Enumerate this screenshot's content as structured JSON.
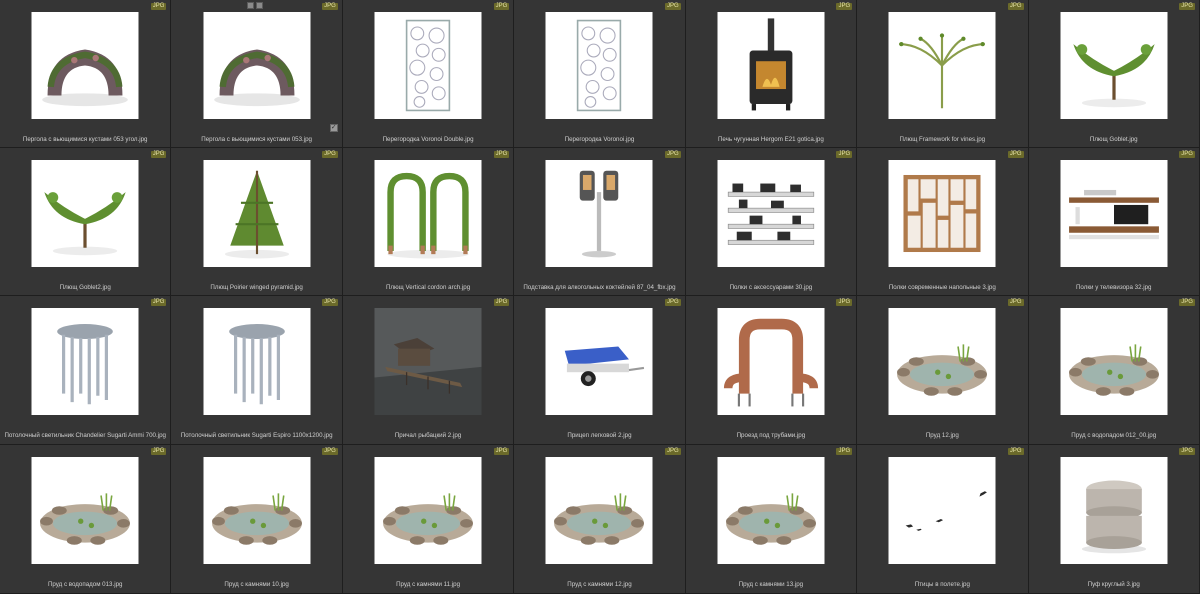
{
  "badge_label": "JPG",
  "thumbnails": [
    {
      "caption": "Пергола с вьющимися кустами 053 угол.jpg",
      "icon": "pergola-bush-icon"
    },
    {
      "caption": "Пергола с вьющимися кустами 053.jpg",
      "icon": "pergola-bush-icon",
      "selected": true
    },
    {
      "caption": "Перегородка Voronoi Double.jpg",
      "icon": "partition-icon"
    },
    {
      "caption": "Перегородка Voronoi.jpg",
      "icon": "partition-icon"
    },
    {
      "caption": "Печь чугунная Hergom E21 gotica.jpg",
      "icon": "stove-icon"
    },
    {
      "caption": "Плющ Framework for vines.jpg",
      "icon": "vine-frame-icon"
    },
    {
      "caption": "Плющ Goblet.jpg",
      "icon": "goblet-plant-icon"
    },
    {
      "caption": "Плющ Goblet2.jpg",
      "icon": "goblet-plant-icon"
    },
    {
      "caption": "Плющ Poirier winged pyramid.jpg",
      "icon": "pyramid-tree-icon"
    },
    {
      "caption": "Плющ Vertical cordon arch.jpg",
      "icon": "arch-plant-icon"
    },
    {
      "caption": "Подставка для алкогольных коктейлей 87_04_fbx.jpg",
      "icon": "drink-dispenser-icon"
    },
    {
      "caption": "Полки с аксессуарами 30.jpg",
      "icon": "shelves-icon"
    },
    {
      "caption": "Полки современные напольные 3.jpg",
      "icon": "bookcase-icon"
    },
    {
      "caption": "Полки у телевизора 32.jpg",
      "icon": "tv-shelves-icon"
    },
    {
      "caption": "Потолочный светильник Chandelier Sugarti Ammi 700.jpg",
      "icon": "chandelier-icon"
    },
    {
      "caption": "Потолочный светильник Sugarti Espiro 1100x1200.jpg",
      "icon": "chandelier-icon"
    },
    {
      "caption": "Причал рыбацкий 2.jpg",
      "icon": "pier-icon"
    },
    {
      "caption": "Прицеп легковой 2.jpg",
      "icon": "trailer-icon"
    },
    {
      "caption": "Проезд под трубами.jpg",
      "icon": "pipe-arch-icon"
    },
    {
      "caption": "Пруд 12.jpg",
      "icon": "pond-icon"
    },
    {
      "caption": "Пруд с водопадом 012_00.jpg",
      "icon": "pond-icon"
    },
    {
      "caption": "Пруд с водопадом 013.jpg",
      "icon": "pond-icon"
    },
    {
      "caption": "Пруд с камнями 10.jpg",
      "icon": "pond-icon"
    },
    {
      "caption": "Пруд с камнями 11.jpg",
      "icon": "pond-icon"
    },
    {
      "caption": "Пруд с камнями 12.jpg",
      "icon": "pond-icon"
    },
    {
      "caption": "Пруд с камнями 13.jpg",
      "icon": "pond-icon"
    },
    {
      "caption": "Птицы в полете.jpg",
      "icon": "birds-icon"
    },
    {
      "caption": "Пуф круглый 3.jpg",
      "icon": "pouf-icon"
    }
  ]
}
